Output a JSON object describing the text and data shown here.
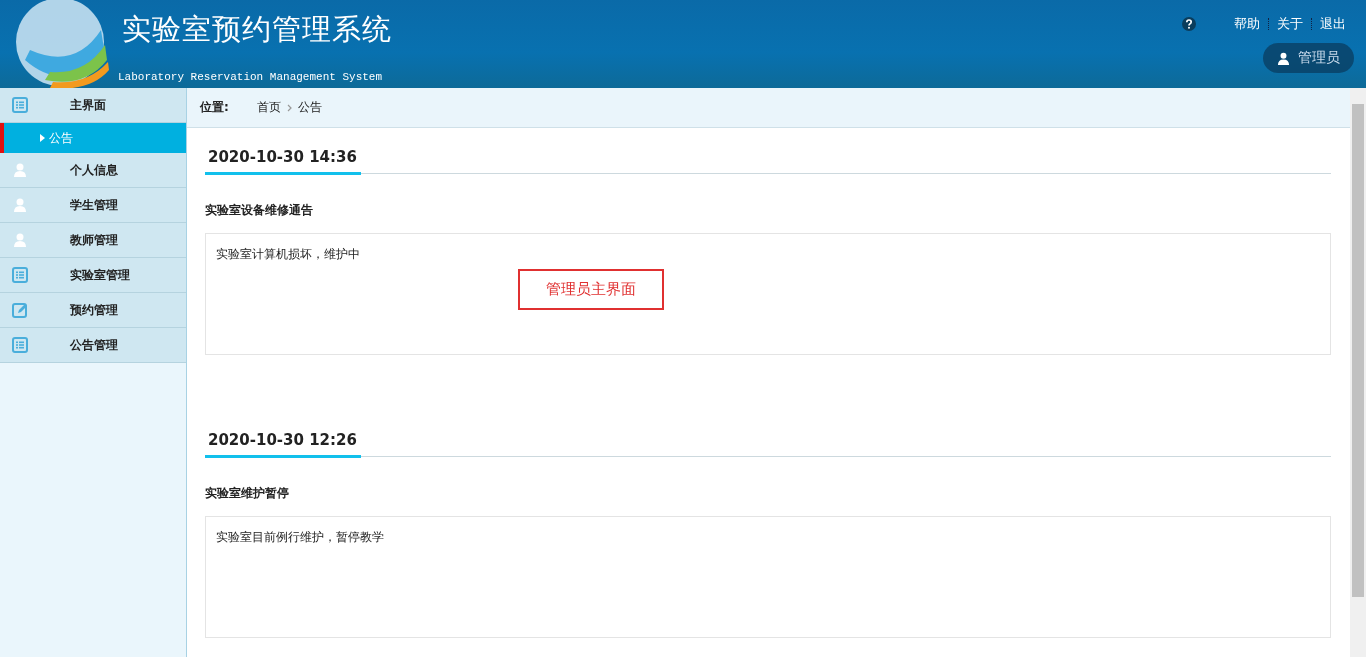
{
  "header": {
    "title": "实验室预约管理系统",
    "subtitle": "Laboratory Reservation Management System",
    "links": [
      "帮助",
      "关于",
      "退出"
    ],
    "user": "管理员"
  },
  "sidebar": {
    "items": [
      {
        "label": "主界面",
        "kind": "list",
        "children": [
          {
            "label": "公告",
            "selected": true
          }
        ]
      },
      {
        "label": "个人信息",
        "kind": "user"
      },
      {
        "label": "学生管理",
        "kind": "user"
      },
      {
        "label": "教师管理",
        "kind": "user"
      },
      {
        "label": "实验室管理",
        "kind": "list"
      },
      {
        "label": "预约管理",
        "kind": "edit"
      },
      {
        "label": "公告管理",
        "kind": "list"
      }
    ]
  },
  "breadcrumb": {
    "label": "位置:",
    "path": [
      "首页",
      "公告"
    ]
  },
  "notices": [
    {
      "date": "2020-10-30 14:36",
      "title": "实验室设备维修通告",
      "body": "实验室计算机损坏，维护中"
    },
    {
      "date": "2020-10-30 12:26",
      "title": "实验室维护暂停",
      "body": "实验室目前例行维护，暂停教学"
    }
  ],
  "callout": "管理员主界面"
}
